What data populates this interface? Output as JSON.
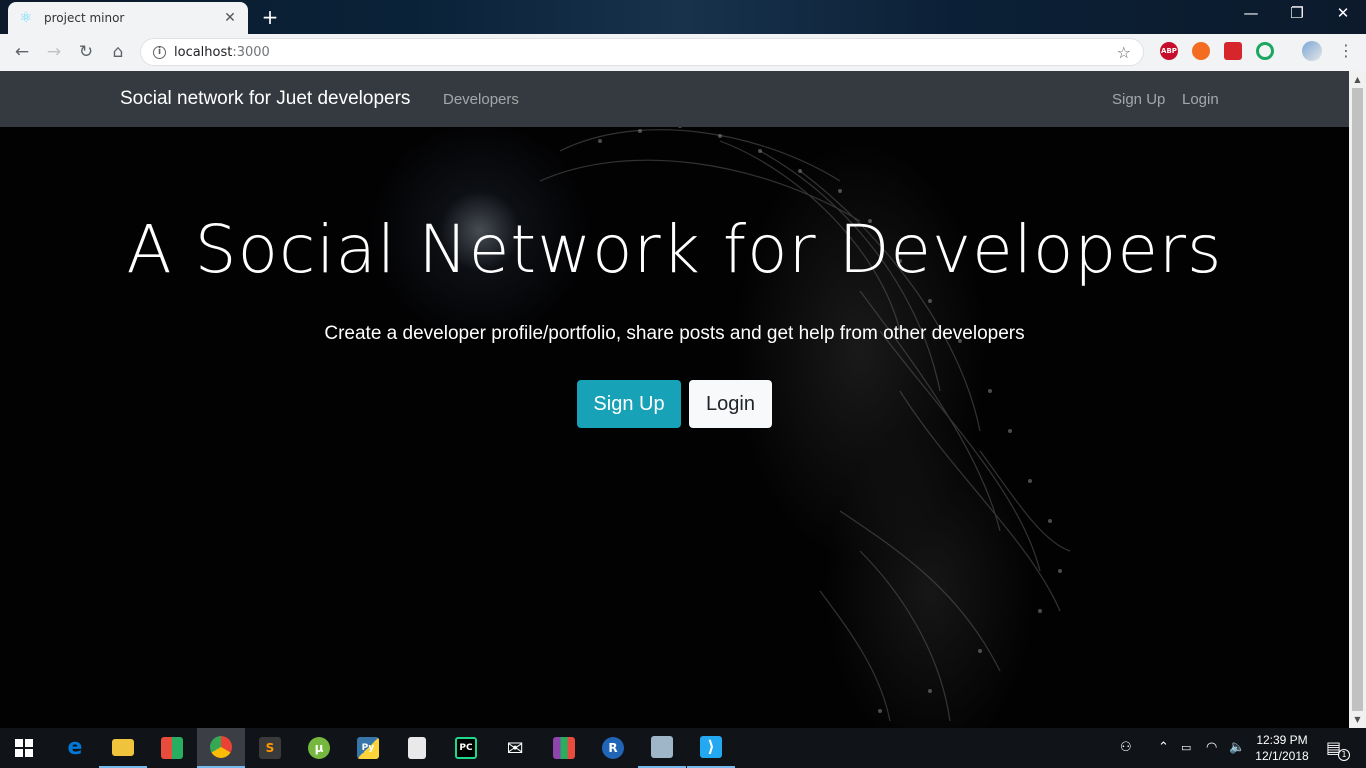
{
  "browser": {
    "tab_title": "project minor",
    "new_tab_icon": "plus-icon",
    "url_host": "localhost",
    "url_port": ":3000",
    "extensions": [
      {
        "name": "adblock-plus-icon",
        "label": "ABP",
        "color": "#c70d2c"
      },
      {
        "name": "flame-extension-icon",
        "label": "",
        "color": "#f36c21"
      },
      {
        "name": "red-extension-icon",
        "label": "",
        "color": "#d6262c"
      },
      {
        "name": "green-ring-extension-icon",
        "label": "",
        "color": "#1ba760"
      }
    ]
  },
  "navbar": {
    "brand": "Social network for Juet developers",
    "developers": "Developers",
    "signup": "Sign Up",
    "login": "Login"
  },
  "hero": {
    "title": "A Social Network for Developers",
    "lead": "Create a developer profile/portfolio, share posts and get help from other developers",
    "signup_button": "Sign Up",
    "login_button": "Login"
  },
  "colors": {
    "navbar_bg": "#343a40",
    "primary_button": "#17a2b8",
    "secondary_button": "#f8f9fa"
  },
  "taskbar": {
    "apps": [
      {
        "name": "edge-icon",
        "label": "e",
        "color": "#0078d7"
      },
      {
        "name": "file-explorer-icon",
        "label": "",
        "color": "#f0c33c"
      },
      {
        "name": "store-icon",
        "label": "",
        "color": "#e74c3c"
      },
      {
        "name": "chrome-icon",
        "label": "",
        "color": "#4285f4"
      },
      {
        "name": "sublime-text-icon",
        "label": "S",
        "color": "#ff9800"
      },
      {
        "name": "utorrent-icon",
        "label": "µ",
        "color": "#76b83f"
      },
      {
        "name": "python-icon",
        "label": "Py",
        "color": "#3776ab"
      },
      {
        "name": "notepad-python-icon",
        "label": "",
        "color": "#e9e9e9"
      },
      {
        "name": "pycharm-icon",
        "label": "PC",
        "color": "#21d789"
      },
      {
        "name": "mail-icon",
        "label": "✉",
        "color": "#ffffff"
      },
      {
        "name": "winrar-icon",
        "label": "",
        "color": "#8e44ad"
      },
      {
        "name": "r-studio-icon",
        "label": "R",
        "color": "#2165b6"
      },
      {
        "name": "control-panel-icon",
        "label": "",
        "color": "#9fb6c8"
      },
      {
        "name": "vscode-icon",
        "label": "⟩",
        "color": "#23a9f2"
      }
    ],
    "time": "12:39 PM",
    "date": "12/1/2018",
    "notification_count": "1"
  }
}
